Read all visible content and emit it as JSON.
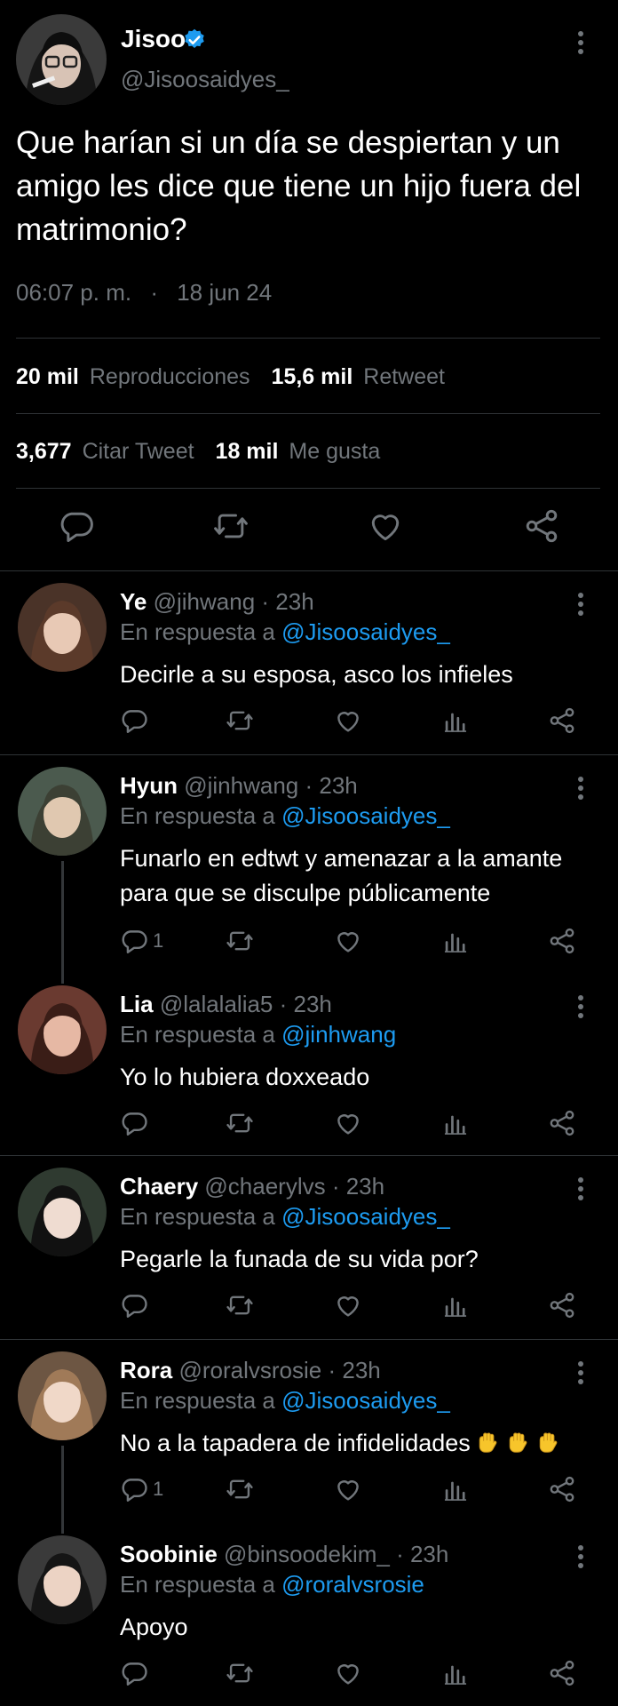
{
  "main_tweet": {
    "name": "Jisoo",
    "handle": "@Jisoosaidyes_",
    "text": "Que harían si un día se despiertan y un amigo les dice que tiene un hijo fuera del matrimonio?",
    "time": "06:07 p. m.",
    "dot": "·",
    "date": "18 jun 24",
    "views_count": "20 mil",
    "views_label": "Reproducciones",
    "retweets_count": "15,6 mil",
    "retweets_label": "Retweet",
    "quotes_count": "3,677",
    "quotes_label": "Citar Tweet",
    "likes_count": "18 mil",
    "likes_label": "Me gusta"
  },
  "reply_prefix": "En respuesta a",
  "replies": [
    {
      "name": "Ye",
      "handle": "@jihwang",
      "time": "· 23h",
      "reply_to": "@Jisoosaidyes_",
      "text": "Decirle a su esposa, asco los infieles",
      "reply_count": ""
    },
    {
      "name": "Hyun",
      "handle": "@jinhwang",
      "time": "· 23h",
      "reply_to": "@Jisoosaidyes_",
      "text": "Funarlo en edtwt y amenazar a la amante para que se disculpe públicamente",
      "reply_count": "1"
    },
    {
      "name": "Lia",
      "handle": "@lalalalia5",
      "time": "· 23h",
      "reply_to": "@jinhwang",
      "text": "Yo lo hubiera doxxeado",
      "reply_count": ""
    },
    {
      "name": "Chaery",
      "handle": "@chaerylvs",
      "time": "· 23h",
      "reply_to": "@Jisoosaidyes_",
      "text": "Pegarle la funada de su vida por?",
      "reply_count": ""
    },
    {
      "name": "Rora",
      "handle": "@roralvsrosie",
      "time": "· 23h",
      "reply_to": "@Jisoosaidyes_",
      "text": "No a la tapadera de infidelidades",
      "reply_count": "1"
    },
    {
      "name": "Soobinie",
      "handle": "@binsoodekim_",
      "time": "· 23h",
      "reply_to": "@roralvsrosie",
      "text": "Apoyo",
      "reply_count": ""
    }
  ],
  "icons": {
    "reply": "reply-bubble-icon",
    "retweet": "retweet-icon",
    "like": "heart-icon",
    "views": "views-bar-icon",
    "share": "share-icon",
    "more": "more-vertical-icon",
    "verified": "verified-badge-icon",
    "emoji": "raised-fist-emoji"
  },
  "colors": {
    "background": "#000000",
    "text": "#e7e9ea",
    "secondary": "#71767b",
    "link": "#1d9bf0",
    "divider": "#2f3336"
  }
}
